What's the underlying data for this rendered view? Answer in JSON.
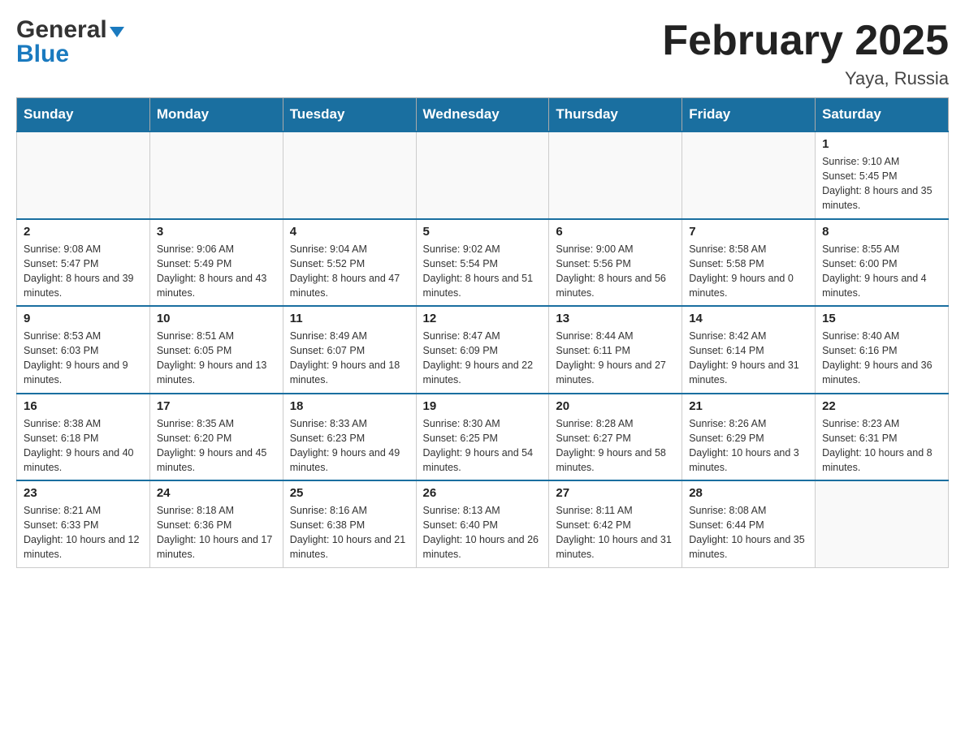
{
  "header": {
    "logo_main": "General",
    "logo_sub": "Blue",
    "calendar_title": "February 2025",
    "location": "Yaya, Russia"
  },
  "days_of_week": [
    "Sunday",
    "Monday",
    "Tuesday",
    "Wednesday",
    "Thursday",
    "Friday",
    "Saturday"
  ],
  "weeks": [
    [
      {
        "day": "",
        "info": ""
      },
      {
        "day": "",
        "info": ""
      },
      {
        "day": "",
        "info": ""
      },
      {
        "day": "",
        "info": ""
      },
      {
        "day": "",
        "info": ""
      },
      {
        "day": "",
        "info": ""
      },
      {
        "day": "1",
        "info": "Sunrise: 9:10 AM\nSunset: 5:45 PM\nDaylight: 8 hours and 35 minutes."
      }
    ],
    [
      {
        "day": "2",
        "info": "Sunrise: 9:08 AM\nSunset: 5:47 PM\nDaylight: 8 hours and 39 minutes."
      },
      {
        "day": "3",
        "info": "Sunrise: 9:06 AM\nSunset: 5:49 PM\nDaylight: 8 hours and 43 minutes."
      },
      {
        "day": "4",
        "info": "Sunrise: 9:04 AM\nSunset: 5:52 PM\nDaylight: 8 hours and 47 minutes."
      },
      {
        "day": "5",
        "info": "Sunrise: 9:02 AM\nSunset: 5:54 PM\nDaylight: 8 hours and 51 minutes."
      },
      {
        "day": "6",
        "info": "Sunrise: 9:00 AM\nSunset: 5:56 PM\nDaylight: 8 hours and 56 minutes."
      },
      {
        "day": "7",
        "info": "Sunrise: 8:58 AM\nSunset: 5:58 PM\nDaylight: 9 hours and 0 minutes."
      },
      {
        "day": "8",
        "info": "Sunrise: 8:55 AM\nSunset: 6:00 PM\nDaylight: 9 hours and 4 minutes."
      }
    ],
    [
      {
        "day": "9",
        "info": "Sunrise: 8:53 AM\nSunset: 6:03 PM\nDaylight: 9 hours and 9 minutes."
      },
      {
        "day": "10",
        "info": "Sunrise: 8:51 AM\nSunset: 6:05 PM\nDaylight: 9 hours and 13 minutes."
      },
      {
        "day": "11",
        "info": "Sunrise: 8:49 AM\nSunset: 6:07 PM\nDaylight: 9 hours and 18 minutes."
      },
      {
        "day": "12",
        "info": "Sunrise: 8:47 AM\nSunset: 6:09 PM\nDaylight: 9 hours and 22 minutes."
      },
      {
        "day": "13",
        "info": "Sunrise: 8:44 AM\nSunset: 6:11 PM\nDaylight: 9 hours and 27 minutes."
      },
      {
        "day": "14",
        "info": "Sunrise: 8:42 AM\nSunset: 6:14 PM\nDaylight: 9 hours and 31 minutes."
      },
      {
        "day": "15",
        "info": "Sunrise: 8:40 AM\nSunset: 6:16 PM\nDaylight: 9 hours and 36 minutes."
      }
    ],
    [
      {
        "day": "16",
        "info": "Sunrise: 8:38 AM\nSunset: 6:18 PM\nDaylight: 9 hours and 40 minutes."
      },
      {
        "day": "17",
        "info": "Sunrise: 8:35 AM\nSunset: 6:20 PM\nDaylight: 9 hours and 45 minutes."
      },
      {
        "day": "18",
        "info": "Sunrise: 8:33 AM\nSunset: 6:23 PM\nDaylight: 9 hours and 49 minutes."
      },
      {
        "day": "19",
        "info": "Sunrise: 8:30 AM\nSunset: 6:25 PM\nDaylight: 9 hours and 54 minutes."
      },
      {
        "day": "20",
        "info": "Sunrise: 8:28 AM\nSunset: 6:27 PM\nDaylight: 9 hours and 58 minutes."
      },
      {
        "day": "21",
        "info": "Sunrise: 8:26 AM\nSunset: 6:29 PM\nDaylight: 10 hours and 3 minutes."
      },
      {
        "day": "22",
        "info": "Sunrise: 8:23 AM\nSunset: 6:31 PM\nDaylight: 10 hours and 8 minutes."
      }
    ],
    [
      {
        "day": "23",
        "info": "Sunrise: 8:21 AM\nSunset: 6:33 PM\nDaylight: 10 hours and 12 minutes."
      },
      {
        "day": "24",
        "info": "Sunrise: 8:18 AM\nSunset: 6:36 PM\nDaylight: 10 hours and 17 minutes."
      },
      {
        "day": "25",
        "info": "Sunrise: 8:16 AM\nSunset: 6:38 PM\nDaylight: 10 hours and 21 minutes."
      },
      {
        "day": "26",
        "info": "Sunrise: 8:13 AM\nSunset: 6:40 PM\nDaylight: 10 hours and 26 minutes."
      },
      {
        "day": "27",
        "info": "Sunrise: 8:11 AM\nSunset: 6:42 PM\nDaylight: 10 hours and 31 minutes."
      },
      {
        "day": "28",
        "info": "Sunrise: 8:08 AM\nSunset: 6:44 PM\nDaylight: 10 hours and 35 minutes."
      },
      {
        "day": "",
        "info": ""
      }
    ]
  ]
}
